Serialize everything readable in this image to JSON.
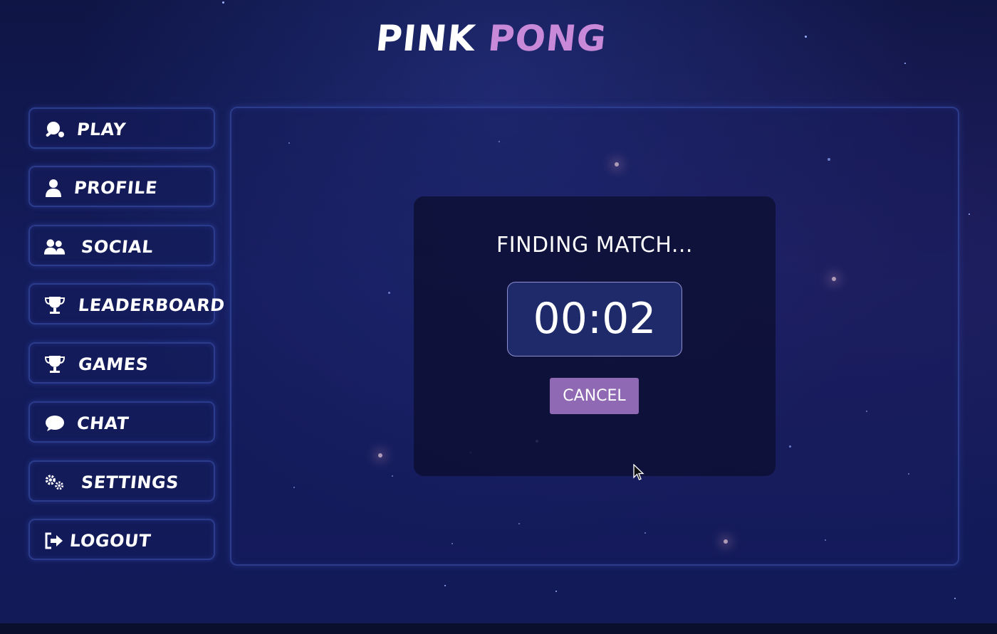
{
  "app": {
    "logo_word_1": "PINK",
    "logo_word_2": "PONG"
  },
  "sidebar": {
    "items": [
      {
        "label": "PLAY",
        "icon": "ping-pong-icon"
      },
      {
        "label": "PROFILE",
        "icon": "user-icon"
      },
      {
        "label": "SOCIAL",
        "icon": "users-icon"
      },
      {
        "label": "LEADERBOARD",
        "icon": "trophy-icon"
      },
      {
        "label": "GAMES",
        "icon": "trophy-icon"
      },
      {
        "label": "CHAT",
        "icon": "chat-bubble-icon"
      },
      {
        "label": "SETTINGS",
        "icon": "gears-icon"
      },
      {
        "label": "LOGOUT",
        "icon": "logout-icon"
      }
    ]
  },
  "matchmaking": {
    "title": "FINDING MATCH...",
    "timer": "00:02",
    "cancel_label": "CANCEL"
  },
  "colors": {
    "background": "#121a58",
    "logo_accent": "#c889d9",
    "cancel_button": "#8f69b3",
    "timer_box": "#1f2a6a",
    "panel_border": "#2c3c8c"
  }
}
